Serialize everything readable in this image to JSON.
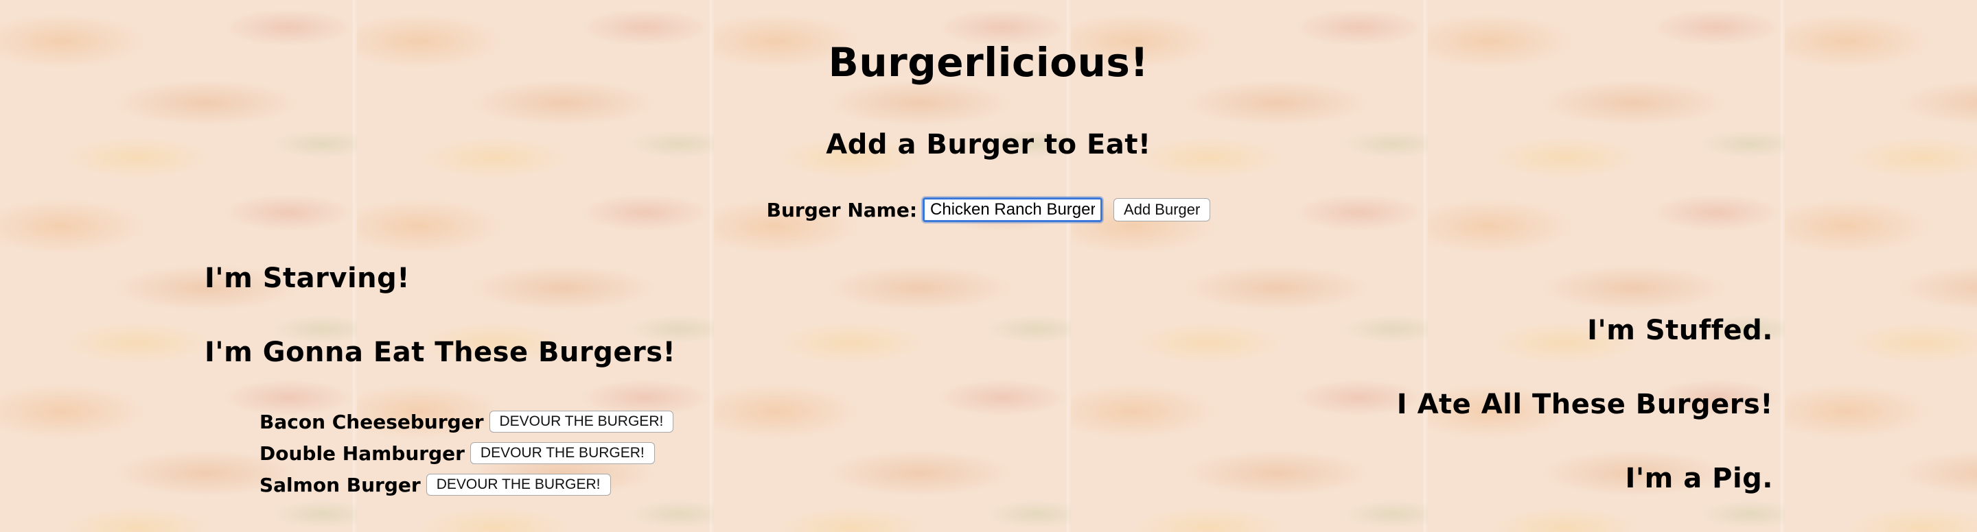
{
  "header": {
    "title": "Burgerlicious!",
    "subtitle": "Add a Burger to Eat!"
  },
  "form": {
    "label": "Burger Name:",
    "input_value": "Chicken Ranch Burger",
    "submit_label": "Add Burger"
  },
  "uneaten": {
    "heading": "I'm Starving!",
    "subheading": "I'm Gonna Eat These Burgers!",
    "devour_label": "DEVOUR THE BURGER!",
    "items": [
      {
        "name": "Bacon Cheeseburger"
      },
      {
        "name": "Double Hamburger"
      },
      {
        "name": "Salmon Burger"
      }
    ]
  },
  "eaten": {
    "heading": "I'm Stuffed.",
    "subheading": "I Ate All These Burgers!",
    "footer": "I'm a Pig."
  },
  "colors": {
    "background": "#f4dcc8",
    "input_focus": "#3b78d8",
    "text": "#000000"
  }
}
